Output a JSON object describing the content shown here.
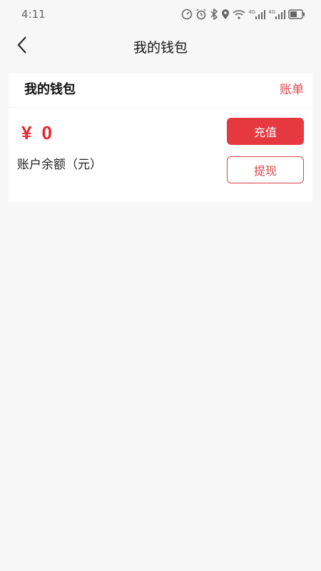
{
  "status_bar": {
    "time": "4:11",
    "icons": [
      "speedometer-icon",
      "alarm-icon",
      "bluetooth-icon",
      "location-icon",
      "wifi-icon",
      "signal-4g-icon",
      "signal-4g-icon",
      "battery-icon"
    ],
    "network_label_1": "4G",
    "network_label_2": "4G"
  },
  "nav": {
    "back_icon": "chevron-left-icon",
    "title": "我的钱包"
  },
  "wallet": {
    "title": "我的钱包",
    "bill_label": "账单",
    "currency_symbol": "¥",
    "balance": "0",
    "balance_label": "账户余额（元）",
    "recharge_label": "充值",
    "withdraw_label": "提现"
  },
  "colors": {
    "accent": "#e5393f",
    "amount": "#e8242f",
    "background": "#f7f7f7",
    "card": "#ffffff"
  }
}
